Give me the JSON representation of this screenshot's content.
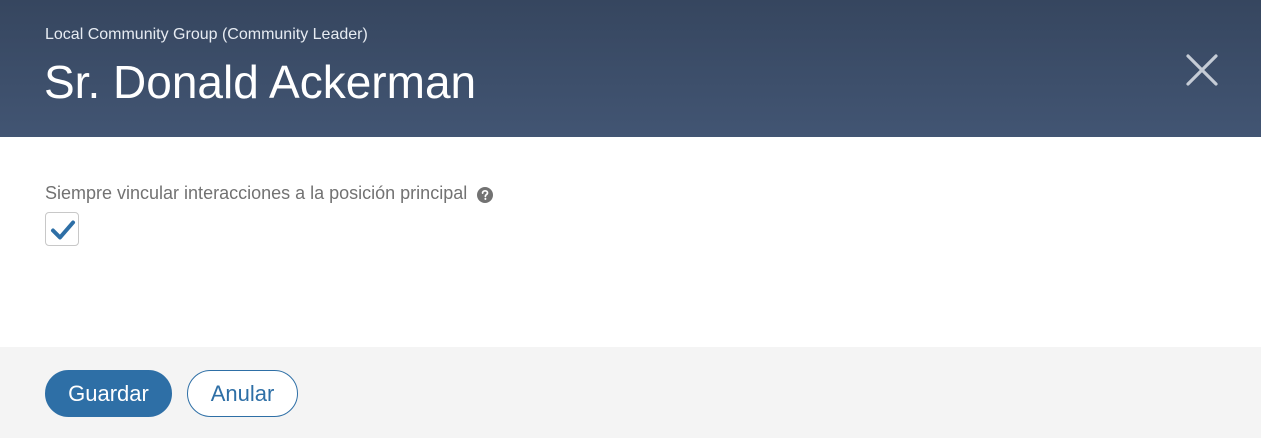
{
  "header": {
    "subtitle": "Local Community Group (Community Leader)",
    "title": "Sr. Donald Ackerman",
    "close_icon": "close-icon"
  },
  "body": {
    "field_label": "Siempre vincular interacciones a la posición principal",
    "help_icon": "question-circle-icon",
    "checkbox_checked": true
  },
  "footer": {
    "save_label": "Guardar",
    "cancel_label": "Anular"
  },
  "colors": {
    "header_bg": "#3d4e69",
    "primary": "#2e6fa6",
    "footer_bg": "#f4f4f4",
    "label_text": "#727272"
  }
}
